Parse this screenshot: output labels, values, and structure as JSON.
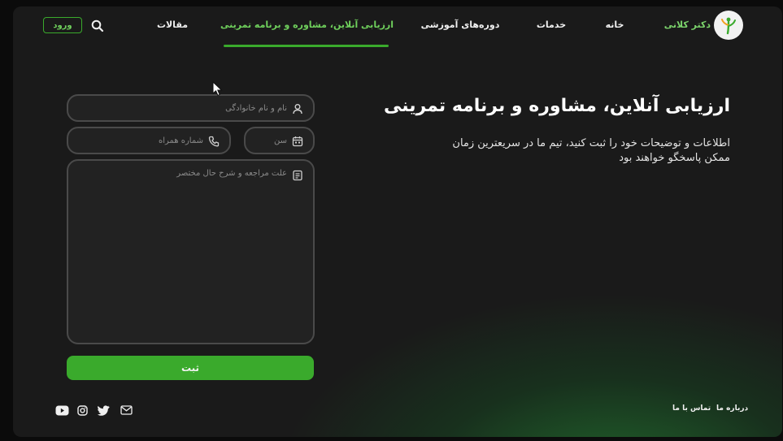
{
  "header": {
    "brand": "دکتر کلانی",
    "nav": [
      {
        "label": "خانه"
      },
      {
        "label": "خدمات"
      },
      {
        "label": "دوره‌های آموزشی"
      },
      {
        "label": "ارزیابی آنلاین، مشاوره و برنامه تمرینی",
        "active": true
      },
      {
        "label": "مقالات"
      }
    ],
    "login_label": "ورود"
  },
  "hero": {
    "title": "ارزیابی آنلاین، مشاوره و برنامه تمرینی",
    "description": "اطلاعات و توضیحات خود را ثبت کنید، تیم ما در سریعترین زمان ممکن پاسخگو خواهند بود"
  },
  "form": {
    "name_placeholder": "نام و نام خانوادگی",
    "phone_placeholder": "شماره همراه",
    "age_placeholder": "سن",
    "reason_placeholder": "علت مراجعه و شرح حال مختصر",
    "submit_label": "ثبت"
  },
  "footer": {
    "links": [
      {
        "label": "درباره ما"
      },
      {
        "label": "تماس با ما"
      }
    ],
    "social_icons": [
      "youtube-icon",
      "instagram-icon",
      "twitter-icon",
      "mail-icon"
    ]
  },
  "colors": {
    "accent": "#3aaa2c",
    "accent_text": "#6fd05c",
    "background": "#1a1a1a"
  }
}
